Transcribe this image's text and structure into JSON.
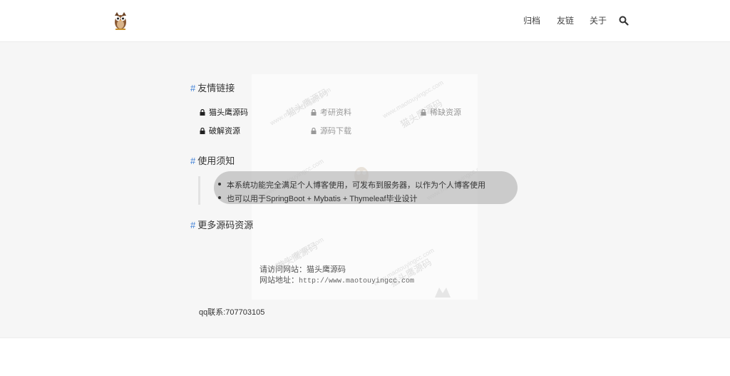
{
  "nav": {
    "logo": "owl-logo",
    "items": [
      {
        "label": "归档"
      },
      {
        "label": "友链"
      },
      {
        "label": "关于"
      }
    ],
    "search_icon": "search-icon"
  },
  "sections": {
    "friend_links": {
      "title": "友情链接",
      "links": [
        {
          "label": "猫头鹰源码",
          "active": true
        },
        {
          "label": "考研资料",
          "active": false
        },
        {
          "label": "稀缺资源",
          "active": false
        },
        {
          "label": "破解资源",
          "active": true
        },
        {
          "label": "源码下载",
          "active": false
        }
      ]
    },
    "notice": {
      "title": "使用须知",
      "items": [
        "本系统功能完全满足个人博客使用，可发布到服务器，以作为个人博客使用",
        "也可以用于SpringBoot + Mybatis + Thymeleaf毕业设计"
      ]
    },
    "more": {
      "title": "更多源码资源",
      "visit_label": "请访问网站：",
      "site_name": "猫头鹰源码",
      "url_label": "网站地址：",
      "url": "http://www.maotouyingcc.com",
      "qq": "qq联系:707703105"
    }
  },
  "watermark": {
    "domain": "www.maotouyingcc.com",
    "name": "猫头鹰源码"
  },
  "colors": {
    "accent": "#3d7fd6",
    "background": "#f6f6f6",
    "header": "#ffffff"
  }
}
